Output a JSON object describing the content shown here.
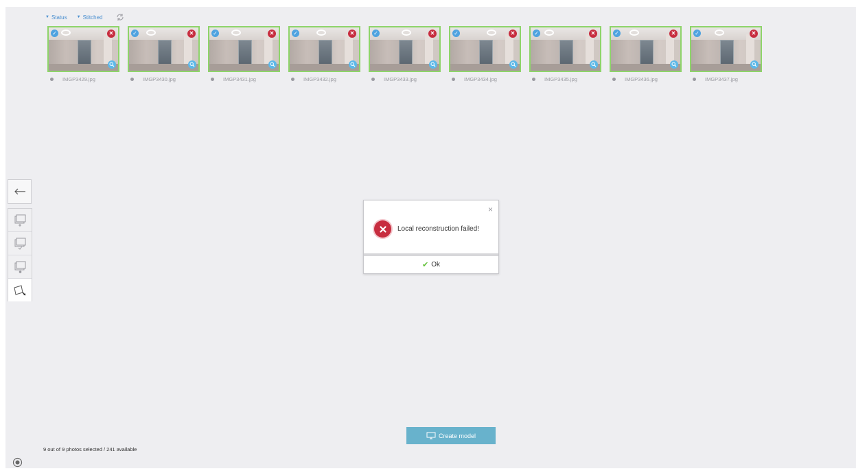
{
  "filters": {
    "status_label": "Status",
    "stitched_label": "Stitched",
    "refresh_icon": "refresh-icon"
  },
  "photos": [
    {
      "filename": "IMGP3429.jpg"
    },
    {
      "filename": "IMGP3430.jpg"
    },
    {
      "filename": "IMGP3431.jpg"
    },
    {
      "filename": "IMGP3432.jpg"
    },
    {
      "filename": "IMGP3433.jpg"
    },
    {
      "filename": "IMGP3434.jpg"
    },
    {
      "filename": "IMGP3435.jpg"
    },
    {
      "filename": "IMGP3436.jpg"
    },
    {
      "filename": "IMGP3437.jpg"
    }
  ],
  "dialog": {
    "message": "Local reconstruction failed!",
    "ok_label": "Ok",
    "close_glyph": "×"
  },
  "footer": {
    "create_label": "Create model",
    "status": "9 out of 9 photos selected / 241 available"
  },
  "colors": {
    "selected_border": "#8ed46a",
    "error": "#c72d3f",
    "accent": "#4a8fd0",
    "create_button": "#68b2cc"
  }
}
